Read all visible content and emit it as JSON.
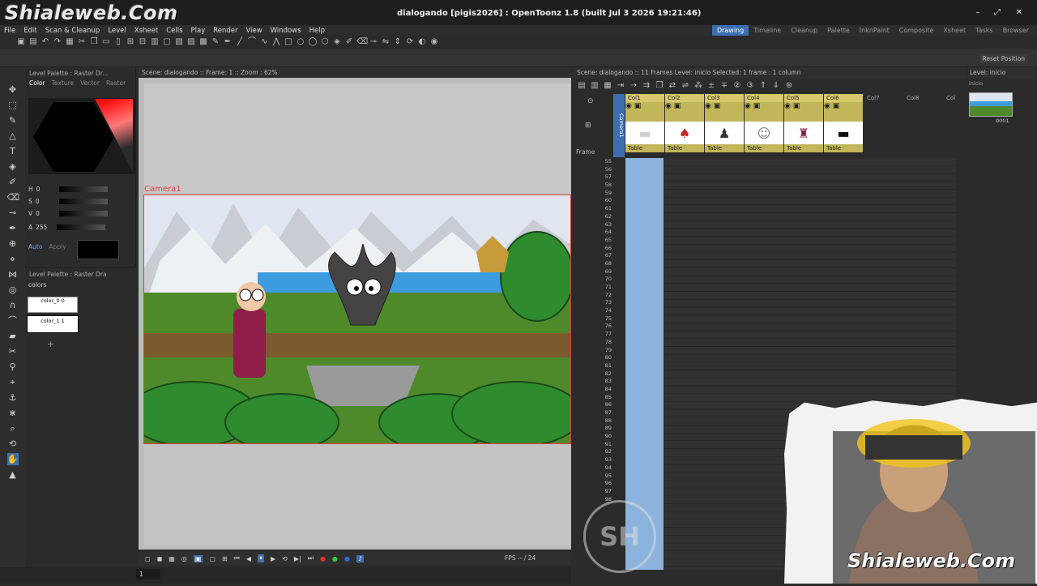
{
  "watermark": {
    "top": "Shialeweb.Com",
    "bottom": "Shialeweb.Com",
    "logo": "SH"
  },
  "window": {
    "title": "dialogando [pigis2026] : OpenToonz 1.8 (built Jul  3 2026 19:21:46)"
  },
  "menu": [
    "File",
    "Edit",
    "Scan & Cleanup",
    "Level",
    "Xsheet",
    "Cells",
    "Play",
    "Render",
    "View",
    "Windows",
    "Help"
  ],
  "rooms": [
    "Drawing",
    "Timeline",
    "Cleanup",
    "Palette",
    "InknPaint",
    "Composite",
    "Xsheet",
    "Tasks",
    "Browser"
  ],
  "reset_position": "Reset Position",
  "style_editor": {
    "title": "Level Palette : Raster Dr...",
    "tabs": [
      "Color",
      "Texture",
      "Vector",
      "Raster"
    ],
    "h": {
      "label": "H",
      "value": "0"
    },
    "s": {
      "label": "S",
      "value": "0"
    },
    "v": {
      "label": "V",
      "value": "0"
    },
    "a": {
      "label": "A",
      "value": "255"
    },
    "auto": "Auto",
    "apply": "Apply"
  },
  "level_palette": {
    "title": "Level Palette : Raster Dra",
    "name": "colors",
    "chips": [
      {
        "label": "color_0",
        "index": "0"
      },
      {
        "label": "color_1",
        "index": "1"
      }
    ]
  },
  "viewer": {
    "header": "Scene: dialogando  ::  Frame: 1  ::  Zoom : 62%",
    "camera_label": "Camera1"
  },
  "controls": {
    "fps": "FPS -- / 24",
    "frame": "1"
  },
  "xsheet": {
    "header": "Scene: dialogando  ::  11 Frames  Level: inicio  Selected: 1 frame : 1 column",
    "camera_col": "Camera1",
    "frame_label": "Frame",
    "columns": [
      {
        "name": "Col1",
        "peg": "Table",
        "thumb": "▬"
      },
      {
        "name": "Col2",
        "peg": "Table",
        "thumb": "♠"
      },
      {
        "name": "Col3",
        "peg": "Table",
        "thumb": "♟"
      },
      {
        "name": "Col4",
        "peg": "Table",
        "thumb": "☺"
      },
      {
        "name": "Col5",
        "peg": "Table",
        "thumb": "♜"
      },
      {
        "name": "Col6",
        "peg": "Table",
        "thumb": "▬"
      }
    ],
    "empty_columns": [
      "Col7",
      "Col8",
      "Col"
    ],
    "frames": [
      "55",
      "56",
      "57",
      "58",
      "59",
      "60",
      "61",
      "62",
      "63",
      "64",
      "65",
      "66",
      "67",
      "68",
      "69",
      "70",
      "71",
      "72",
      "73",
      "74",
      "75",
      "76",
      "77",
      "78",
      "79",
      "80",
      "81",
      "82",
      "83",
      "84",
      "85",
      "86",
      "87",
      "88",
      "89",
      "90",
      "91",
      "92",
      "93",
      "94",
      "95",
      "96",
      "97",
      "98"
    ]
  },
  "level_strip": {
    "header": "Level: inicio",
    "level_name": "inicio",
    "thumb_frame": "0001"
  },
  "colors": {
    "accent": "#3d6fb0",
    "camera": "#e04040",
    "column": "#d6c86b",
    "selected_cells": "#8bb3dd"
  }
}
